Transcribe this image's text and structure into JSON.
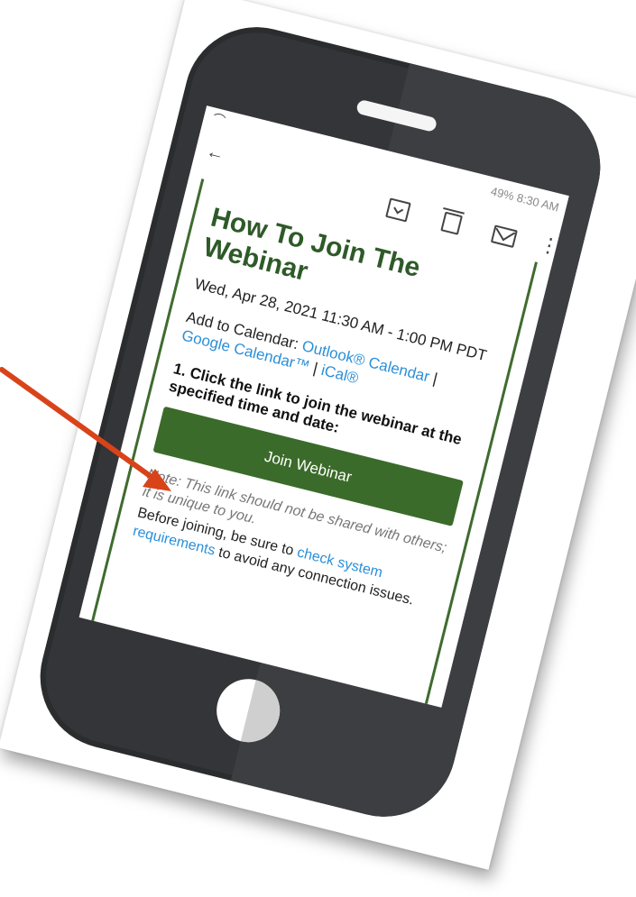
{
  "status_bar": {
    "right_text": "49% 8:30 AM"
  },
  "toolbar": {
    "back_icon": "arrow-left-icon",
    "archive_icon": "archive-icon",
    "delete_icon": "trash-icon",
    "mail_icon": "mail-icon",
    "more_icon": "more-vertical-icon"
  },
  "email": {
    "title": "How To Join The Webinar",
    "datetime": "Wed, Apr 28, 2021 11:30 AM - 1:00 PM PDT",
    "calendar_prefix": "Add to Calendar: ",
    "calendar_outlook": "Outlook® Calendar",
    "calendar_sep1": " | ",
    "calendar_google": "Google Calendar™",
    "calendar_sep2": " | ",
    "calendar_ical": "iCal®",
    "step1": "1. Click the link to join the webinar at the specified time and date:",
    "join_button": "Join Webinar",
    "note": "Note: This link should not be shared with others; it is unique to you.",
    "before_prefix": "Before joining, be sure to ",
    "check_link": "check system requirements",
    "before_suffix": " to avoid any connection issues."
  },
  "colors": {
    "accent_green": "#3b6b2a",
    "title_green": "#2e5a28",
    "link_blue": "#2a8fd8",
    "arrow": "#d9431a",
    "phone_body": "#333538"
  }
}
